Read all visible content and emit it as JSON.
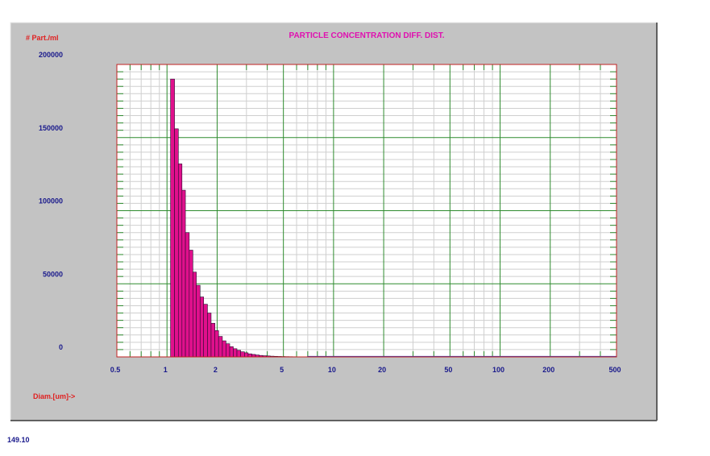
{
  "footer_value": "149.10",
  "colors": {
    "panel": "#c3c3c3",
    "plot_bg": "#ffffff",
    "major_grid": "#2e8b2e",
    "minor_grid": "#cfcfcf",
    "plot_border": "#c02020",
    "bar_fill": "#e0108c",
    "bar_edge": "#2a0a30",
    "tail_line": "#3040c0",
    "title": "#e010b0",
    "axis_title": "#e02020",
    "tick_label": "#1a1a8c"
  },
  "chart_data": {
    "type": "bar",
    "title": "PARTICLE CONCENTRATION DIFF. DIST.",
    "ylabel": "# Part./ml",
    "xlabel": "Diam.[um]->",
    "x_scale": "log",
    "xlim": [
      0.5,
      500
    ],
    "ylim": [
      0,
      200000
    ],
    "grid": true,
    "y_ticks": [
      0,
      50000,
      100000,
      150000,
      200000
    ],
    "y_tick_labels": [
      "0",
      "50000",
      "100000",
      "150000",
      "200000"
    ],
    "x_ticks": [
      0.5,
      1,
      2,
      5,
      10,
      20,
      50,
      100,
      200,
      500
    ],
    "x_tick_labels": [
      "0.5",
      "1",
      "2",
      "5",
      "10",
      "20",
      "50",
      "100",
      "200",
      "500"
    ],
    "bin_edges": [
      1.05,
      1.11,
      1.17,
      1.23,
      1.29,
      1.36,
      1.43,
      1.5,
      1.58,
      1.66,
      1.75,
      1.84,
      1.94,
      2.04,
      2.15,
      2.26,
      2.38,
      2.5,
      2.63,
      2.77,
      2.92,
      3.07,
      3.23,
      3.4,
      3.58,
      3.76,
      3.96,
      4.17,
      4.39,
      4.62,
      4.86,
      5.11,
      5.38,
      5.66,
      5.96,
      6.27,
      6.6,
      6.95
    ],
    "values": [
      190000,
      156000,
      132000,
      114000,
      85000,
      73000,
      58000,
      49000,
      41000,
      36000,
      30000,
      23000,
      18000,
      14000,
      11000,
      9000,
      7000,
      5600,
      4500,
      3500,
      2800,
      2100,
      1700,
      1300,
      1000,
      800,
      650,
      500,
      400,
      320,
      250,
      200,
      160,
      130,
      100,
      80,
      60
    ],
    "tail": {
      "x": [
        6.95,
        10,
        15,
        24,
        30,
        60,
        100,
        200,
        500
      ],
      "y": [
        60,
        40,
        30,
        20,
        8,
        4,
        2,
        1,
        0
      ]
    }
  }
}
